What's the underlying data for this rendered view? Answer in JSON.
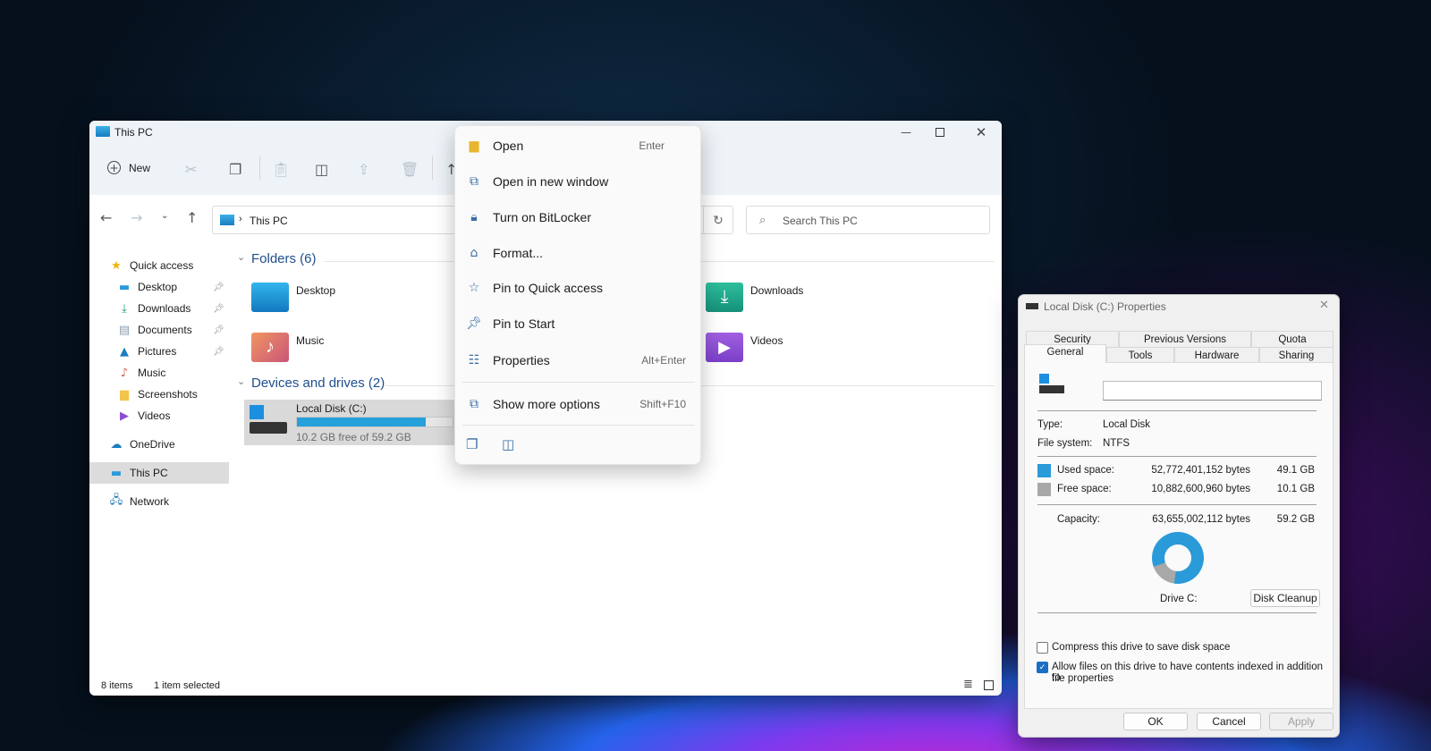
{
  "explorer": {
    "title": "This PC",
    "toolbar": {
      "new_label": "New"
    },
    "address": {
      "crumb": "This PC",
      "search_placeholder": "Search This PC"
    },
    "sidebar": {
      "quick_access": "Quick access",
      "items": [
        {
          "label": "Desktop",
          "pinned": true
        },
        {
          "label": "Downloads",
          "pinned": true
        },
        {
          "label": "Documents",
          "pinned": true
        },
        {
          "label": "Pictures",
          "pinned": true
        },
        {
          "label": "Music"
        },
        {
          "label": "Screenshots"
        },
        {
          "label": "Videos"
        }
      ],
      "onedrive": "OneDrive",
      "this_pc": "This PC",
      "network": "Network"
    },
    "folders_header": "Folders (6)",
    "folders": [
      "Desktop",
      "Downloads",
      "Music",
      "Videos"
    ],
    "drives_header": "Devices and drives (2)",
    "drive": {
      "name": "Local Disk (C:)",
      "free_text": "10.2 GB free of 59.2 GB",
      "used_fraction": 0.83
    },
    "status": {
      "count": "8 items",
      "selected": "1 item selected"
    }
  },
  "context_menu": {
    "items": [
      {
        "label": "Open",
        "shortcut": "Enter"
      },
      {
        "label": "Open in new window"
      },
      {
        "label": "Turn on BitLocker"
      },
      {
        "label": "Format..."
      },
      {
        "label": "Pin to Quick access"
      },
      {
        "label": "Pin to Start"
      },
      {
        "label": "Properties",
        "shortcut": "Alt+Enter"
      }
    ],
    "more": {
      "label": "Show more options",
      "shortcut": "Shift+F10"
    }
  },
  "properties": {
    "title": "Local Disk (C:) Properties",
    "tabs_row1": [
      "Security",
      "Previous Versions",
      "Quota"
    ],
    "tabs_row2": [
      "General",
      "Tools",
      "Hardware",
      "Sharing"
    ],
    "name_value": "",
    "type_label": "Type:",
    "type_value": "Local Disk",
    "fs_label": "File system:",
    "fs_value": "NTFS",
    "used_label": "Used space:",
    "used_bytes": "52,772,401,152 bytes",
    "used_gb": "49.1 GB",
    "free_label": "Free space:",
    "free_bytes": "10,882,600,960 bytes",
    "free_gb": "10.1 GB",
    "cap_label": "Capacity:",
    "cap_bytes": "63,655,002,112 bytes",
    "cap_gb": "59.2 GB",
    "used_fraction": 0.829,
    "drive_label": "Drive C:",
    "cleanup": "Disk Cleanup",
    "compress": {
      "label": "Compress this drive to save disk space",
      "checked": false
    },
    "index": {
      "label1": "Allow files on this drive to have contents indexed in addition to",
      "label2": "file properties",
      "checked": true
    },
    "ok": "OK",
    "cancel": "Cancel",
    "apply": "Apply",
    "colors": {
      "used": "#2a9ad9",
      "free": "#a8a8a8"
    }
  }
}
